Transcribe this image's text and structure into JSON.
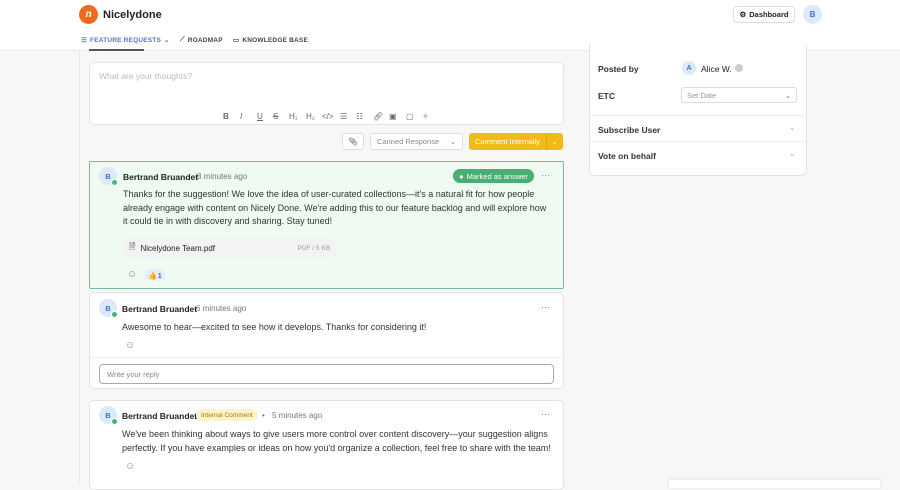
{
  "header": {
    "brand": "Nicelydone",
    "dashboard": "Dashboard",
    "user_initial": "B",
    "nav": [
      {
        "label": "FEATURE REQUESTS"
      },
      {
        "label": "ROADMAP"
      },
      {
        "label": "KNOWLEDGE BASE"
      }
    ]
  },
  "editor": {
    "placeholder": "What are your thoughts?",
    "toolbar": [
      "B",
      "I",
      "U",
      "S",
      "H1",
      "H2",
      "</>",
      "list",
      "olist",
      "link",
      "image",
      "embed",
      "magic"
    ],
    "canned": "Canned Response",
    "submit": "Comment Internally"
  },
  "comments": [
    {
      "initial": "B",
      "author": "Bertrand Bruandet",
      "time": "8 minutes ago",
      "badge": "Marked as answer",
      "text": "Thanks for the suggestion! We love the idea of user-curated collections—it's a natural fit for how people already engage with content on Nicely Done. We're adding this to our feature backlog and will explore how it could tie in with discovery and sharing. Stay tuned!",
      "file": {
        "name": "Nicelydone Team.pdf",
        "meta": "PDF / 5 KB"
      },
      "reaction": {
        "emoji": "👍",
        "count": "1"
      }
    },
    {
      "initial": "B",
      "author": "Bertrand Bruandet",
      "time": "6 minutes ago",
      "text": "Awesome to hear—excited to see how it develops. Thanks for considering it!",
      "reply_placeholder": "Write your reply"
    },
    {
      "initial": "B",
      "author": "Bertrand Bruandet",
      "badge": "Internal Comment",
      "time": "5 minutes ago",
      "text": "We've been thinking about ways to give users more control over content discovery—your suggestion aligns perfectly. If you have examples or ideas on how you'd organize a collection, feel free to share with the team!"
    }
  ],
  "sidebar": {
    "posted_by_label": "Posted by",
    "poster_initial": "A",
    "poster": "Alice W.",
    "etc_label": "ETC",
    "etc_placeholder": "Set Date",
    "subscribe": "Subscribe User",
    "vote": "Vote on behalf"
  },
  "colors": {
    "accent": "#5a6fd1",
    "brand": "#ee6a1f",
    "answer": "#49ad74",
    "internal": "#f1b919"
  }
}
